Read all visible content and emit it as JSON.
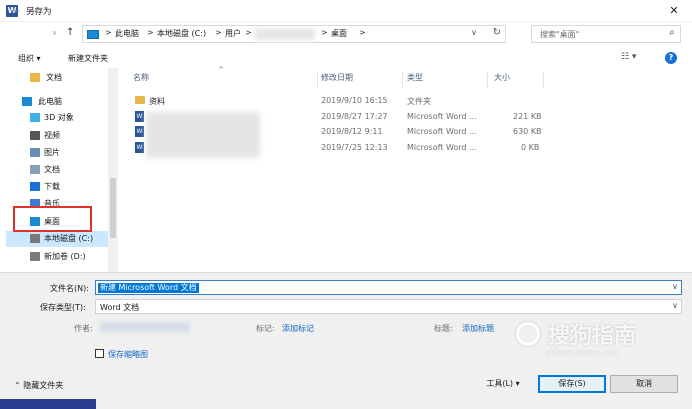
{
  "window": {
    "app_icon": "W",
    "title": "另存为",
    "close": "✕"
  },
  "nav": {
    "back": "←",
    "forward": "→",
    "dropdown": "∨",
    "up": "↑"
  },
  "address": {
    "segments": [
      "此电脑",
      "本地磁盘 (C:)",
      "用户",
      "桌面"
    ],
    "separator": ">",
    "refresh": "↻"
  },
  "search": {
    "placeholder": "搜索\"桌面\""
  },
  "toolbar": {
    "organize": "组织 ▾",
    "new_folder": "新建文件夹",
    "view": "☷ ▾",
    "help": "?"
  },
  "sidebar": {
    "items": [
      {
        "label": "文档",
        "icon": "folder-icon"
      },
      {
        "label": "此电脑",
        "icon": "computer-icon"
      },
      {
        "label": "3D 对象",
        "icon": "3d-objects-icon"
      },
      {
        "label": "视频",
        "icon": "video-icon"
      },
      {
        "label": "图片",
        "icon": "pictures-icon"
      },
      {
        "label": "文档",
        "icon": "documents-icon"
      },
      {
        "label": "下载",
        "icon": "download-icon"
      },
      {
        "label": "音乐",
        "icon": "music-icon"
      },
      {
        "label": "桌面",
        "icon": "desktop-icon"
      },
      {
        "label": "本地磁盘 (C:)",
        "icon": "drive-icon"
      },
      {
        "label": "新加卷 (D:)",
        "icon": "drive-icon"
      }
    ]
  },
  "columns": {
    "name": "名称",
    "date": "修改日期",
    "type": "类型",
    "size": "大小"
  },
  "files": [
    {
      "name": "资料",
      "date": "2019/9/10 16:15",
      "type": "文件夹",
      "size": "",
      "icon": "folder-icon"
    },
    {
      "name": "",
      "date": "2019/8/27 17:27",
      "type": "Microsoft Word ...",
      "size": "221 KB",
      "icon": "word-icon"
    },
    {
      "name": "",
      "date": "2019/8/12 9:11",
      "type": "Microsoft Word ...",
      "size": "630 KB",
      "icon": "word-icon"
    },
    {
      "name": "",
      "date": "2019/7/25 12:13",
      "type": "Microsoft Word ...",
      "size": "0 KB",
      "icon": "word-icon"
    }
  ],
  "form": {
    "filename_label": "文件名(N):",
    "filename_value": "新建 Microsoft Word 文档",
    "filetype_label": "保存类型(T):",
    "filetype_value": "Word 文档",
    "author_label": "作者:",
    "tags_label": "标记:",
    "tags_link": "添加标记",
    "title_label": "标题:",
    "title_link": "添加标题",
    "thumbnail_label": "保存缩略图"
  },
  "footer": {
    "hide_folders": "隐藏文件夹",
    "tools": "工具(L) ▾",
    "save": "保存(S)",
    "cancel": "取消"
  },
  "watermark": {
    "text": "搜狗指南",
    "sub": "zhinan.sogou.com"
  },
  "colors": {
    "accent": "#0078d7",
    "highlight_box": "#e0322c",
    "word_blue": "#2b579a",
    "folder_yellow": "#e8b94a"
  }
}
